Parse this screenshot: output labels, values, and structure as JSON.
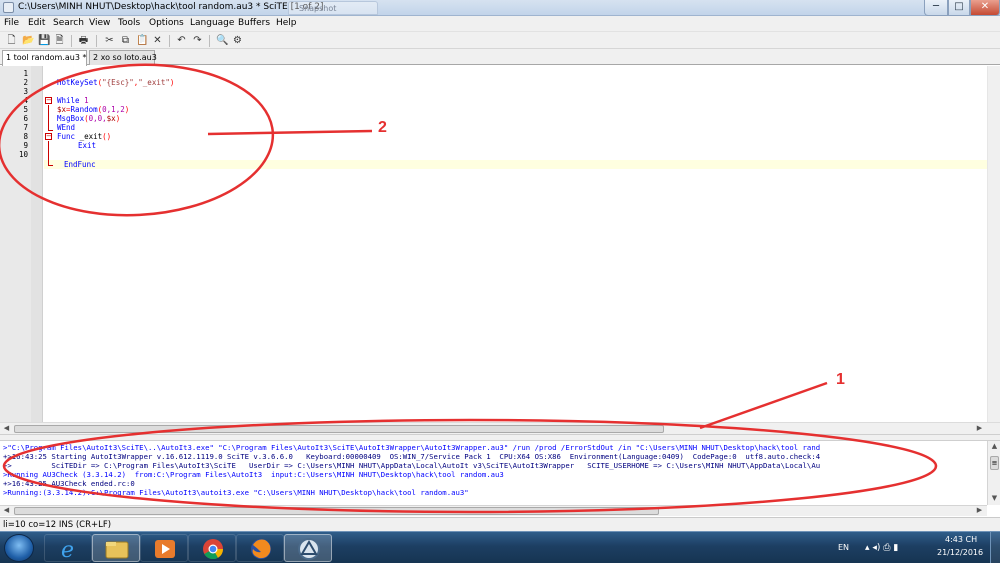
{
  "window": {
    "title": "C:\\Users\\MINH NHUT\\Desktop\\hack\\tool random.au3 * SciTE [1 of 2]",
    "ghost_tab_label": "Snapshot",
    "minimize_icon": "minimize-icon",
    "maximize_icon": "maximize-icon",
    "close_icon": "close-icon",
    "minimize_glyph": "─",
    "maximize_glyph": "□",
    "close_glyph": "✕"
  },
  "menu": {
    "items": [
      "File",
      "Edit",
      "Search",
      "View",
      "Tools",
      "Options",
      "Language",
      "Buffers",
      "Help"
    ]
  },
  "toolbar": {
    "icons": [
      "new-file-icon",
      "open-icon",
      "save-icon",
      "save-as-icon",
      "print-icon",
      "cut-icon",
      "copy-icon",
      "paste-icon",
      "delete-icon",
      "undo-icon",
      "redo-icon",
      "find-icon",
      "replace-icon"
    ],
    "glyphs": {
      "new": "🗋",
      "open": "📂",
      "save": "💾",
      "saveas": "🗎",
      "print": "🖶",
      "cut": "✂",
      "copy": "⧉",
      "paste": "📋",
      "delete": "✕",
      "undo": "↶",
      "redo": "↷",
      "find": "🔍",
      "replace": "⚙"
    }
  },
  "tabs": [
    {
      "label": "1 tool random.au3 *",
      "active": true
    },
    {
      "label": "2 xo so loto.au3",
      "active": false
    }
  ],
  "editor": {
    "line_numbers": [
      "1",
      "2",
      "3",
      "4",
      "5",
      "6",
      "7",
      "8",
      "9",
      "10"
    ],
    "lines": {
      "l2_func": "HotKeySet",
      "l2_open": "(",
      "l2_arg1": "\"{Esc}\"",
      "l2_comma": ",",
      "l2_arg2": "\"_exit\"",
      "l2_close": ")",
      "l4_kw": "While",
      "l4_num": "1",
      "l5_var": "$x",
      "l5_eq": "=",
      "l5_fn": "Random",
      "l5_args_open": "(",
      "l5_args": "0,1,2",
      "l5_args_close": ")",
      "l6_fn": "MsgBox",
      "l6_open": "(",
      "l6_args": "0,0,",
      "l6_var": "$x",
      "l6_close": ")",
      "l7_kw": "WEnd",
      "l8_kw": "Func",
      "l8_name": "_exit",
      "l8_parens": "()",
      "l9_kw": "Exit",
      "l10_kw": "EndFunc"
    },
    "fold_minus": "−",
    "caret_line": 10
  },
  "output": {
    "lines": [
      ">\"C:\\Program Files\\AutoIt3\\SciTE\\..\\AutoIt3.exe\" \"C:\\Program Files\\AutoIt3\\SciTE\\AutoIt3Wrapper\\AutoIt3Wrapper.au3\" /run /prod /ErrorStdOut /in \"C:\\Users\\MINH NHUT\\Desktop\\hack\\tool rand",
      "+>16:43:25 Starting AutoIt3Wrapper v.16.612.1119.0 SciTE v.3.6.6.0   Keyboard:00000409  OS:WIN_7/Service Pack 1  CPU:X64 OS:X86  Environment(Language:0409)  CodePage:0  utf8.auto.check:4",
      "+>         SciTEDir => C:\\Program Files\\AutoIt3\\SciTE   UserDir => C:\\Users\\MINH NHUT\\AppData\\Local\\AutoIt v3\\SciTE\\AutoIt3Wrapper   SCITE_USERHOME => C:\\Users\\MINH NHUT\\AppData\\Local\\Au",
      ">Running AU3Check (3.3.14.2)  from:C:\\Program Files\\AutoIt3  input:C:\\Users\\MINH NHUT\\Desktop\\hack\\tool random.au3",
      "+>16:43:25 AU3Check ended.rc:0",
      ">Running:(3.3.14.2):C:\\Program Files\\AutoIt3\\autoit3.exe \"C:\\Users\\MINH NHUT\\Desktop\\hack\\tool random.au3\""
    ],
    "scroll_grip": "≡",
    "arrow_up": "▲",
    "arrow_down": "▼",
    "arrow_left": "◀",
    "arrow_right": "▶"
  },
  "statusbar": {
    "text": "li=10 co=12 INS (CR+LF)"
  },
  "taskbar": {
    "apps": [
      "internet-explorer-icon",
      "file-explorer-icon",
      "media-player-icon",
      "chrome-icon",
      "firefox-icon",
      "autoit-icon"
    ],
    "language": "EN",
    "time": "4:43 CH",
    "date": "21/12/2016",
    "tray_glyphs": "▴ ◂) ⎙ ▮"
  },
  "annotations": {
    "label_1": "1",
    "label_2": "2",
    "color": "#e53030"
  }
}
